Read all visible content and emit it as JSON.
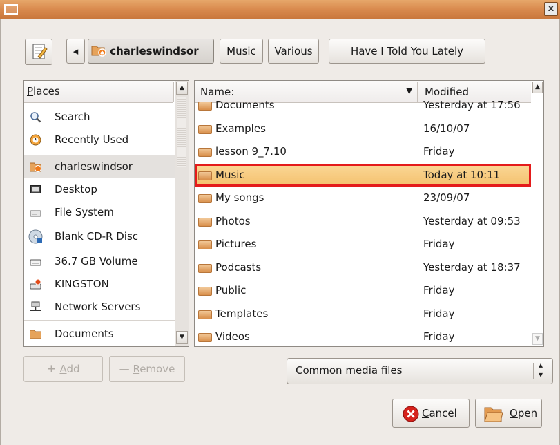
{
  "titlebar": {
    "close_glyph": "x"
  },
  "toolbar": {
    "edit_icon": "edit-location-icon",
    "back_glyph": "◂",
    "crumbs": [
      "charleswindsor",
      "Music",
      "Various",
      "Have I Told You Lately"
    ]
  },
  "places": {
    "header_first": "P",
    "header_rest": "laces",
    "items": [
      {
        "label": "Search",
        "icon": "search-icon"
      },
      {
        "label": "Recently Used",
        "icon": "recent-icon"
      },
      {
        "label": "charleswindsor",
        "icon": "home-folder-icon"
      },
      {
        "label": "Desktop",
        "icon": "desktop-icon"
      },
      {
        "label": "File System",
        "icon": "drive-icon"
      },
      {
        "label": "Blank CD-R Disc",
        "icon": "cd-icon"
      },
      {
        "label": "36.7 GB Volume",
        "icon": "volume-icon"
      },
      {
        "label": "KINGSTON",
        "icon": "usb-drive-icon"
      },
      {
        "label": "Network Servers",
        "icon": "network-icon"
      },
      {
        "label": "Documents",
        "icon": "folder-icon"
      }
    ]
  },
  "files": {
    "header_name": "Name:",
    "header_modified": "Modified",
    "sort_glyph": "▼",
    "rows": [
      {
        "name": "Documents",
        "modified": "Yesterday at 17:56"
      },
      {
        "name": "Examples",
        "modified": "16/10/07"
      },
      {
        "name": "lesson 9_7.10",
        "modified": "Friday"
      },
      {
        "name": "Music",
        "modified": "Today at 10:11"
      },
      {
        "name": "My songs",
        "modified": "23/09/07"
      },
      {
        "name": "Photos",
        "modified": "Yesterday at 09:53"
      },
      {
        "name": "Pictures",
        "modified": "Friday"
      },
      {
        "name": "Podcasts",
        "modified": "Yesterday at 18:37"
      },
      {
        "name": "Public",
        "modified": "Friday"
      },
      {
        "name": "Templates",
        "modified": "Friday"
      },
      {
        "name": "Videos",
        "modified": "Friday"
      }
    ],
    "selected": "Music"
  },
  "buttons": {
    "add_first": "A",
    "add_rest": "dd",
    "remove_first": "R",
    "remove_rest": "emove",
    "cancel_first": "C",
    "cancel_rest": "ancel",
    "open_first": "O",
    "open_rest": "pen"
  },
  "filter": {
    "value": "Common media files",
    "arrows": "▴▾"
  },
  "colors": {
    "title_bar": "#d98a4e",
    "selection": "#f4c06c",
    "highlight_box": "#e41b1b"
  }
}
